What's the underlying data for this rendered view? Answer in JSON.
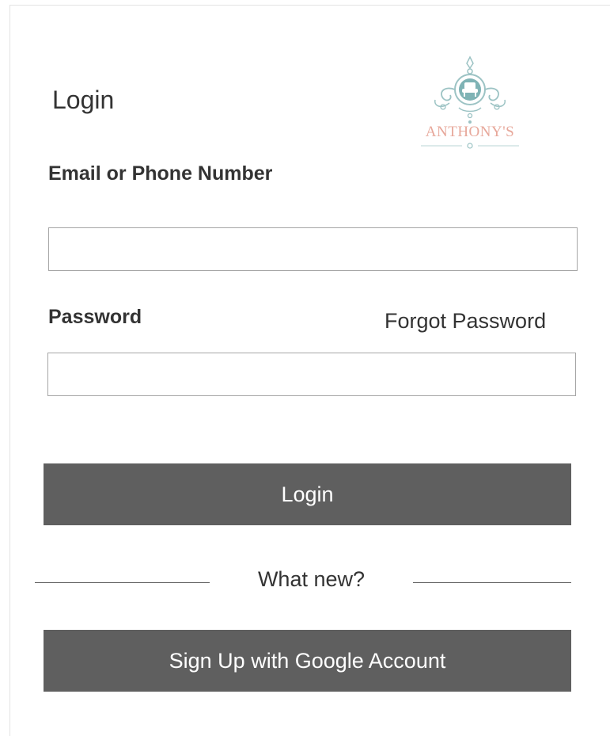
{
  "login_form": {
    "title": "Login",
    "logo_text": "ANTHONY'S",
    "email": {
      "label": "Email or Phone Number",
      "value": "",
      "placeholder": ""
    },
    "password": {
      "label": "Password",
      "value": "",
      "placeholder": ""
    },
    "forgot_password_label": "Forgot Password",
    "login_button_label": "Login",
    "divider_text": "What new?",
    "google_button_label": "Sign Up with Google Account"
  },
  "colors": {
    "button_bg": "#5f5f5f",
    "button_text": "#ffffff",
    "logo_accent": "#e7a79a",
    "logo_teal": "#7fb3b5"
  },
  "icons": {
    "logo": "anthonys-chair-crest-logo"
  }
}
